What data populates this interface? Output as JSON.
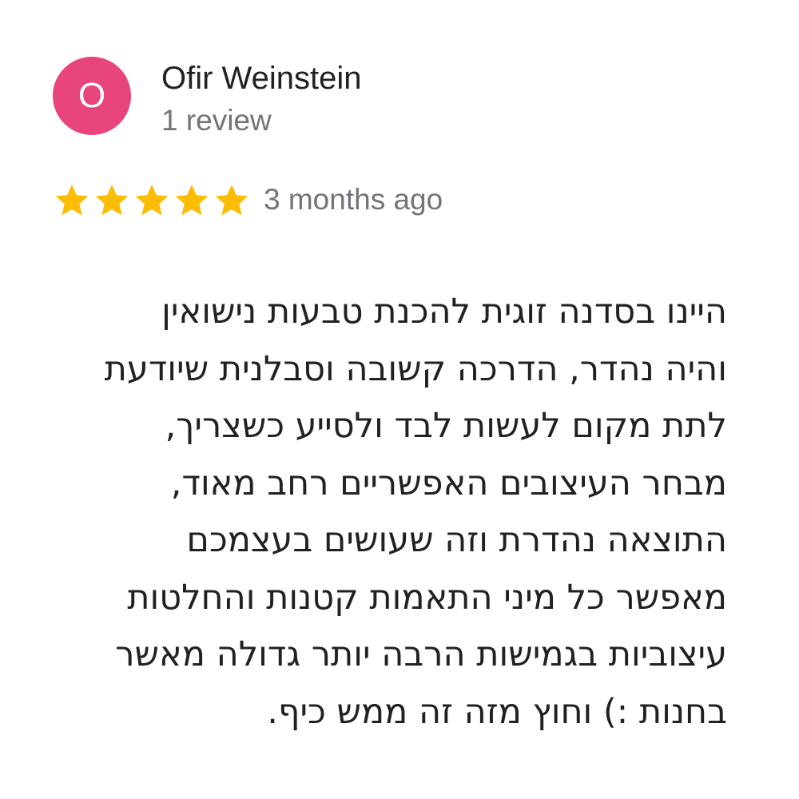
{
  "reviewer": {
    "initial": "O",
    "name": "Ofir Weinstein",
    "review_count": "1 review",
    "avatar_color": "#e8457c"
  },
  "rating": {
    "stars": 5,
    "max_stars": 5,
    "star_color": "#fbbc04",
    "time_ago": "3 months ago"
  },
  "review": {
    "lines": [
      "היינו בסדנה זוגית להכנת טבעות נישואין",
      "והיה נהדר, הדרכה קשובה וסבלנית שיודעת",
      "לתת מקום לעשות לבד ולסייע כשצריך,",
      "מבחר העיצובים האפשריים רחב מאוד,",
      "התוצאה נהדרת וזה שעושים בעצמכם",
      "מאפשר כל מיני התאמות קטנות והחלטות",
      "עיצוביות בגמישות הרבה יותר גדולה מאשר",
      "בחנות :) וחוץ מזה זה ממש כיף."
    ]
  }
}
